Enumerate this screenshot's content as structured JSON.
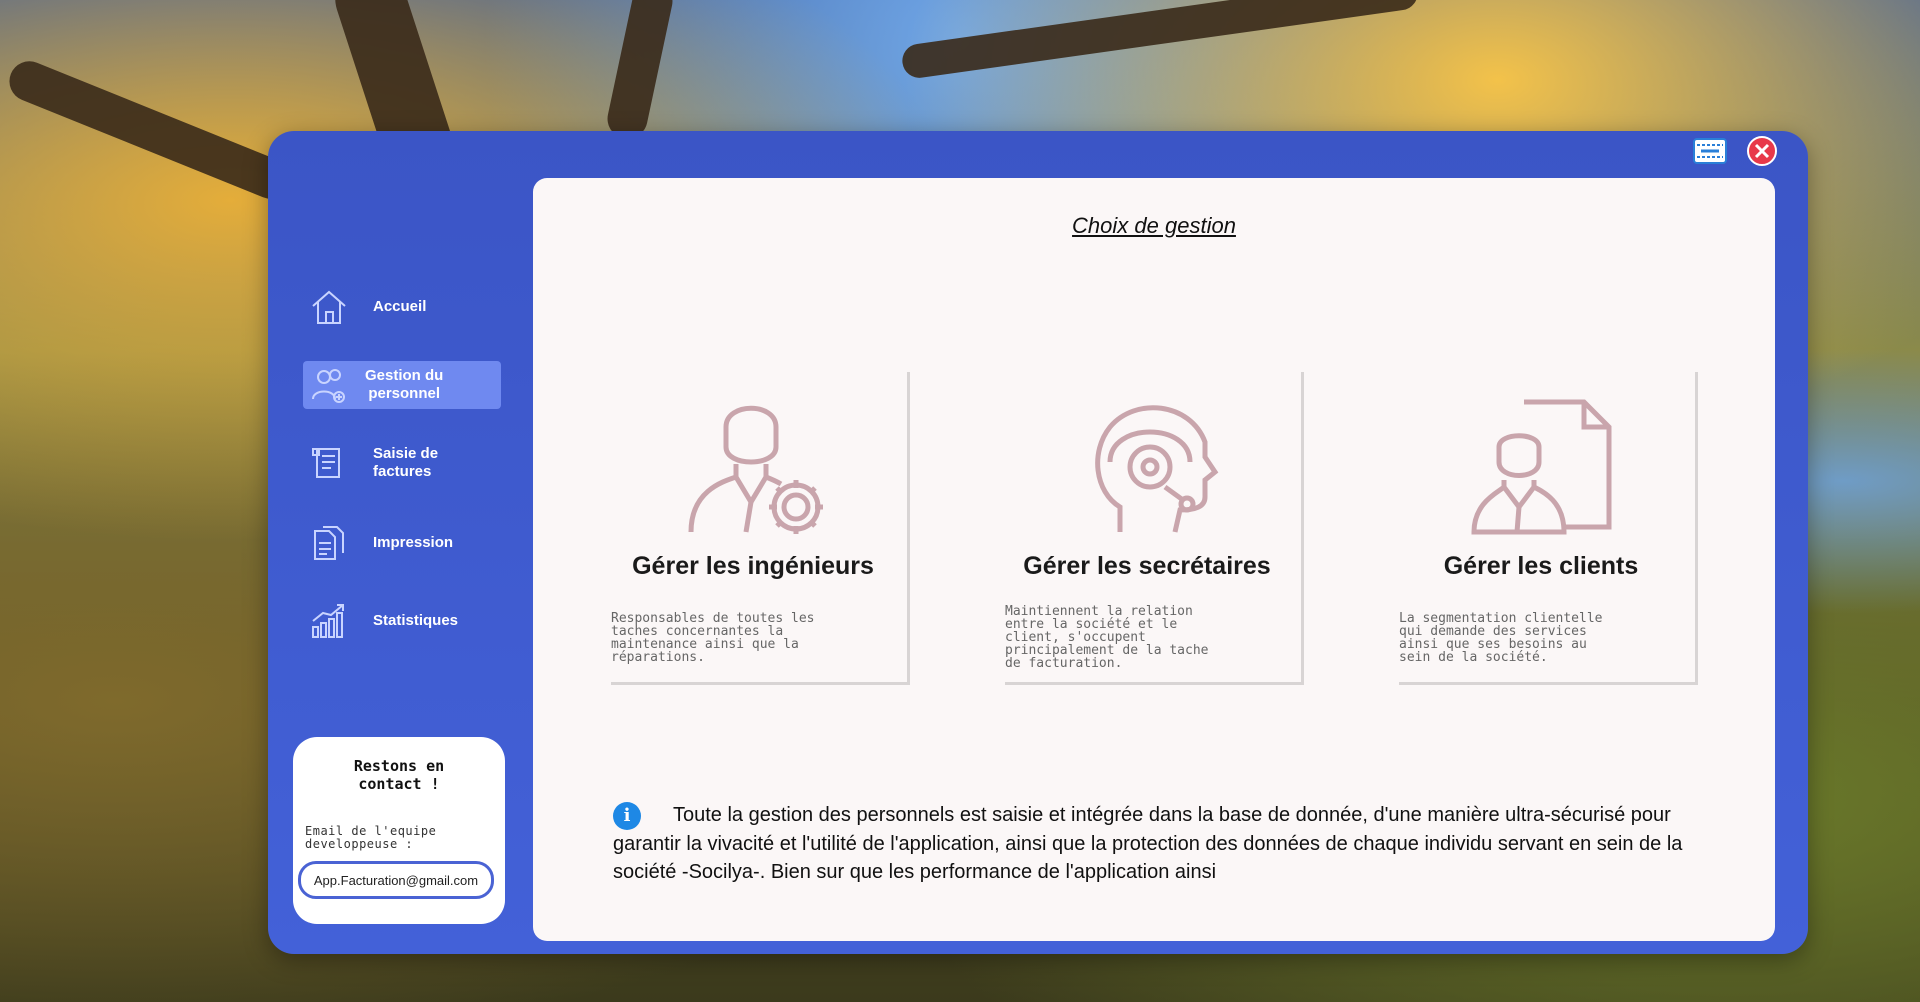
{
  "window": {
    "minimize_icon": "minimize-icon",
    "close_icon": "close-icon",
    "accent": "#3b55c6",
    "panel_bg": "#fbf7f7"
  },
  "sidebar": {
    "items": [
      {
        "label": "Accueil",
        "icon": "home-icon"
      },
      {
        "label": "Gestion du\npersonnel",
        "icon": "users-icon",
        "active": true
      },
      {
        "label": "Saisie de\nfactures",
        "icon": "invoice-icon"
      },
      {
        "label": "Impression",
        "icon": "documents-icon"
      },
      {
        "label": "Statistiques",
        "icon": "stats-icon"
      }
    ]
  },
  "contact": {
    "title": "Restons en\ncontact !",
    "label": "Email de l'equipe\ndeveloppeuse :",
    "email": "App.Facturation@gmail.com"
  },
  "main": {
    "title": "Choix de gestion",
    "cards": [
      {
        "title": "Gérer les ingénieurs",
        "description": "Responsables de toutes les\ntaches concernantes la\nmaintenance ainsi que la\nréparations.",
        "icon": "engineer-icon"
      },
      {
        "title": "Gérer les secrétaires",
        "description": "Maintiennent la relation\nentre la société et le\nclient, s'occupent\nprincipalement de la tache\nde facturation.",
        "icon": "headset-icon"
      },
      {
        "title": "Gérer les clients",
        "description": "La segmentation clientelle\nqui demande des services\nainsi que ses besoins au\nsein de la société.",
        "icon": "client-document-icon"
      }
    ],
    "info_text": "Toute la gestion des personnels est saisie et intégrée dans la base de donnée, d'une manière ultra-sécurisé pour garantir la vivacité et l'utilité de l'application, ainsi que la protection des données de chaque individu servant en sein de la société -Socilya-. Bien sur que les performance de l'application ainsi"
  }
}
